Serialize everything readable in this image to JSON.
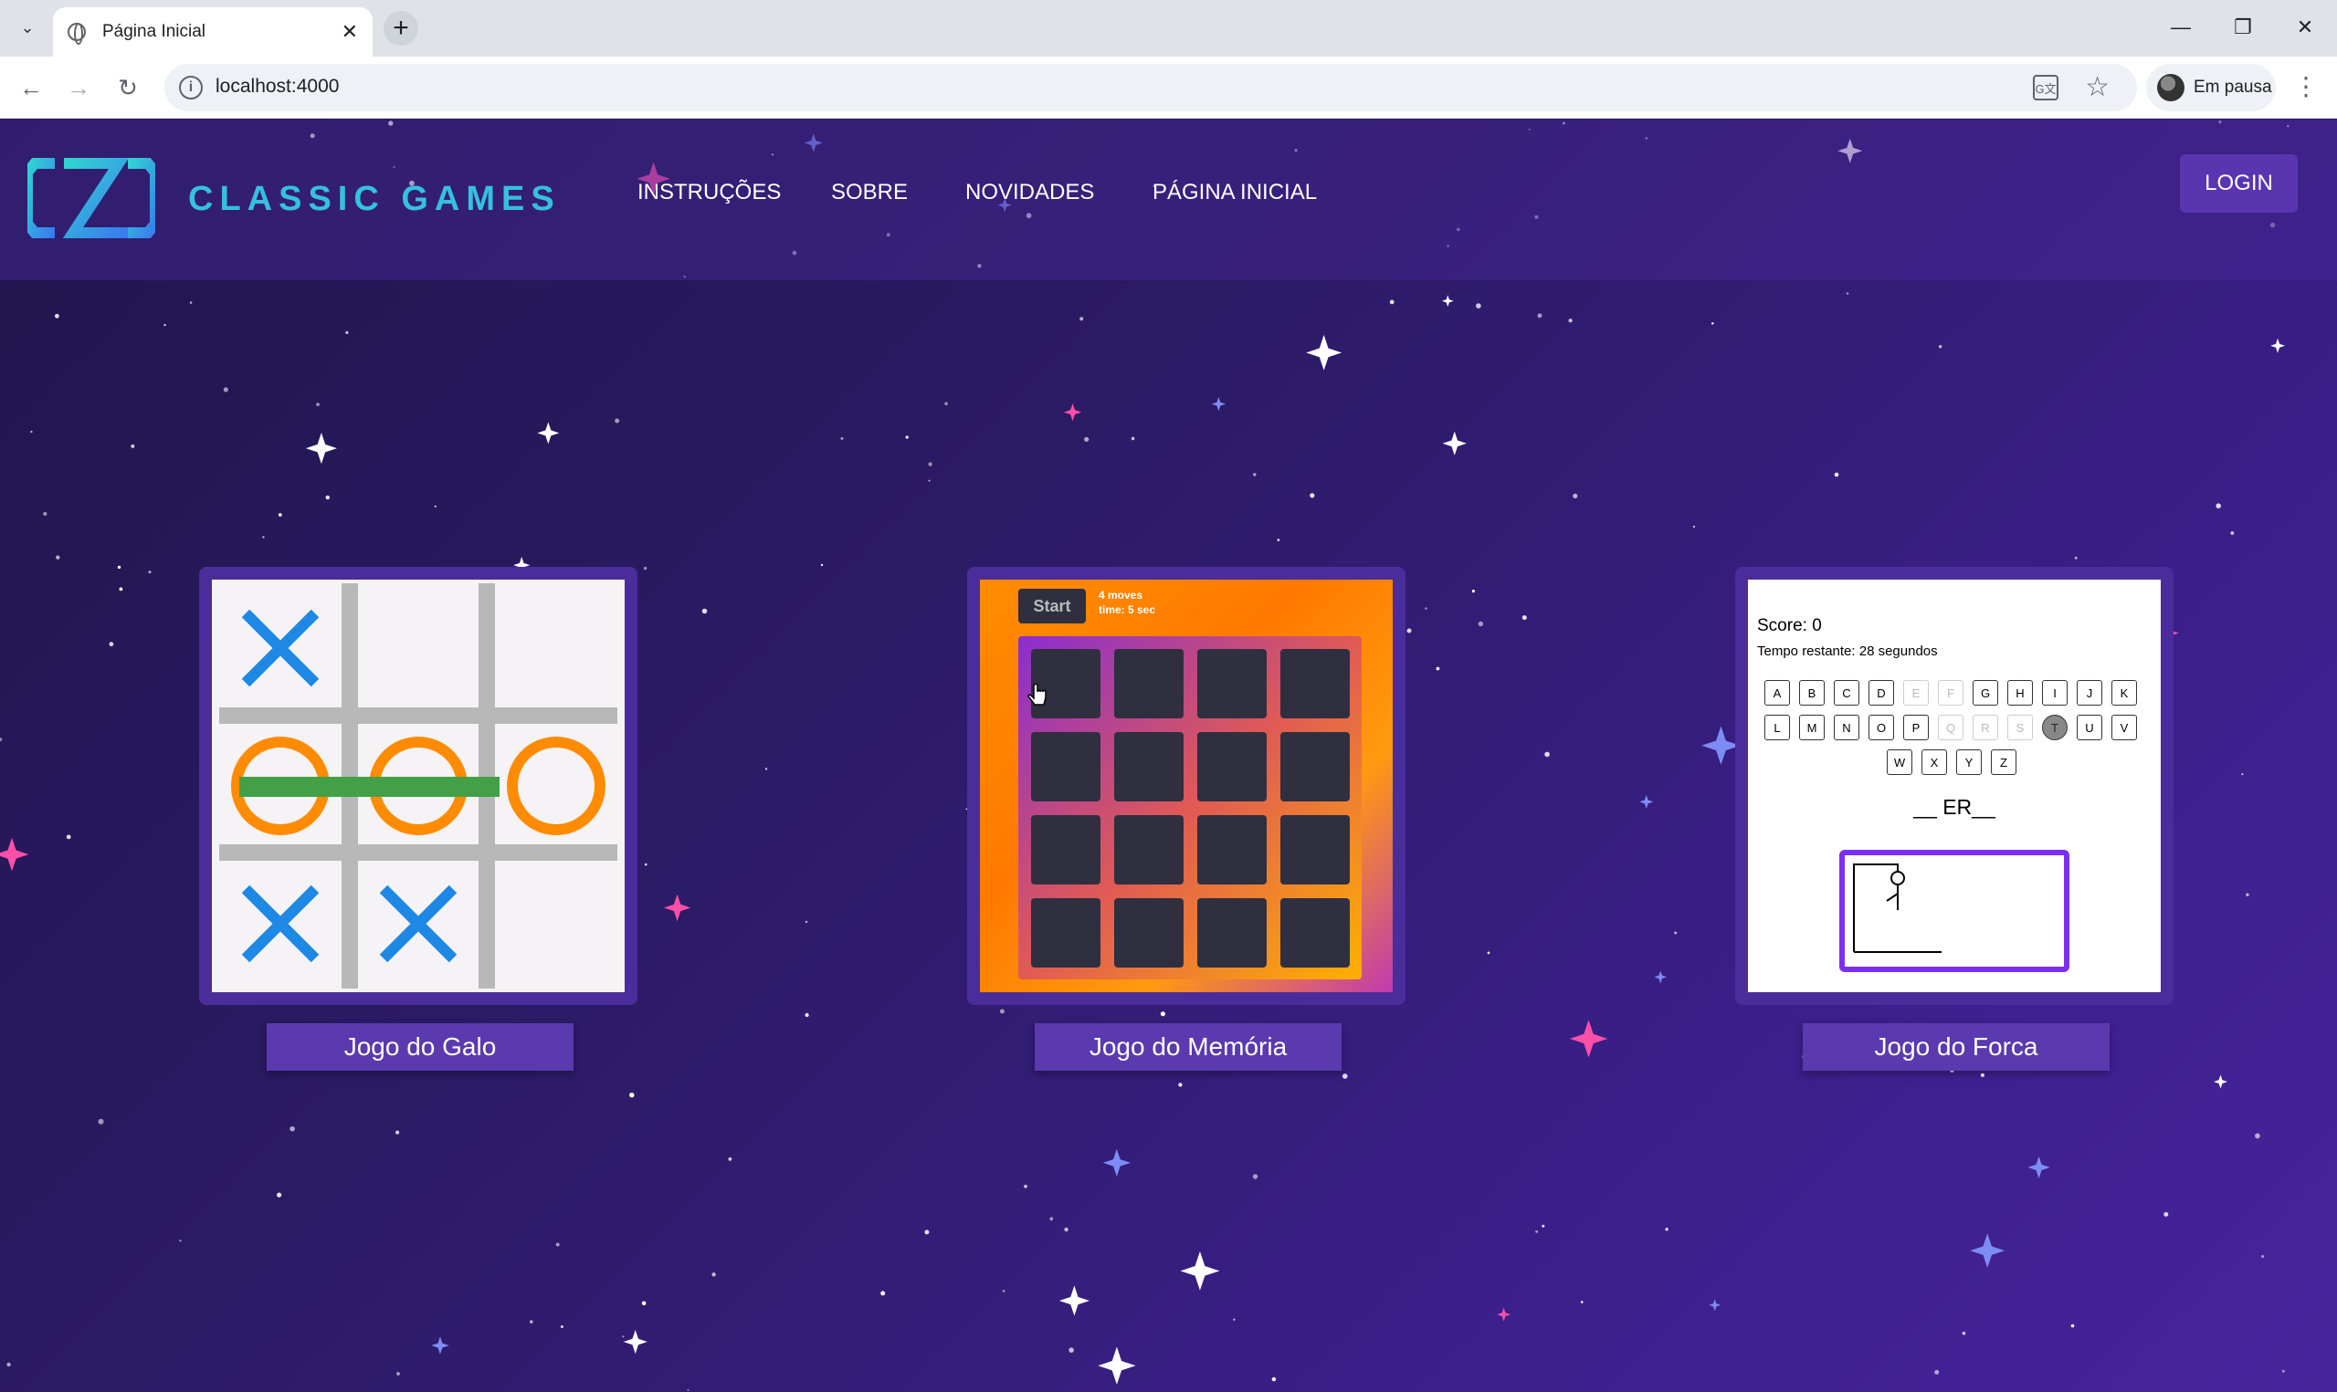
{
  "browser": {
    "tab_title": "Página Inicial",
    "url": "localhost:4000",
    "profile_label": "Em pausa"
  },
  "site": {
    "brand": "CLASSIC GAMES",
    "nav": [
      "INSTRUÇÕES",
      "SOBRE",
      "NOVIDADES",
      "PÁGINA INICIAL"
    ],
    "login": "LOGIN"
  },
  "colors": {
    "background": "#2c1b66",
    "accent": "#5a3aae",
    "brand": "#35c0e0"
  },
  "games": [
    {
      "label": "Jogo do Galo",
      "board": [
        "X",
        "",
        "",
        "O",
        "O",
        "O",
        "X",
        "X",
        ""
      ],
      "winning_line": "middle-row"
    },
    {
      "label": "Jogo do Memória",
      "start_label": "Start",
      "moves_text": "4 moves",
      "time_text": "time: 5 sec",
      "grid_cols": 4,
      "grid_rows": 4
    },
    {
      "label": "Jogo do Forca",
      "score_text": "Score: 0",
      "time_text": "Tempo restante: 28 segundos",
      "keyboard_rows": [
        [
          "A",
          "B",
          "C",
          "D",
          "E",
          "F",
          "G",
          "H",
          "I",
          "J",
          "K"
        ],
        [
          "L",
          "M",
          "N",
          "O",
          "P",
          "Q",
          "R",
          "S",
          "T",
          "U",
          "V"
        ],
        [
          "W",
          "X",
          "Y",
          "Z"
        ]
      ],
      "used_keys": [
        "E",
        "F",
        "Q",
        "R",
        "S"
      ],
      "highlighted_key": "T",
      "word_display": "__ ER__"
    }
  ]
}
